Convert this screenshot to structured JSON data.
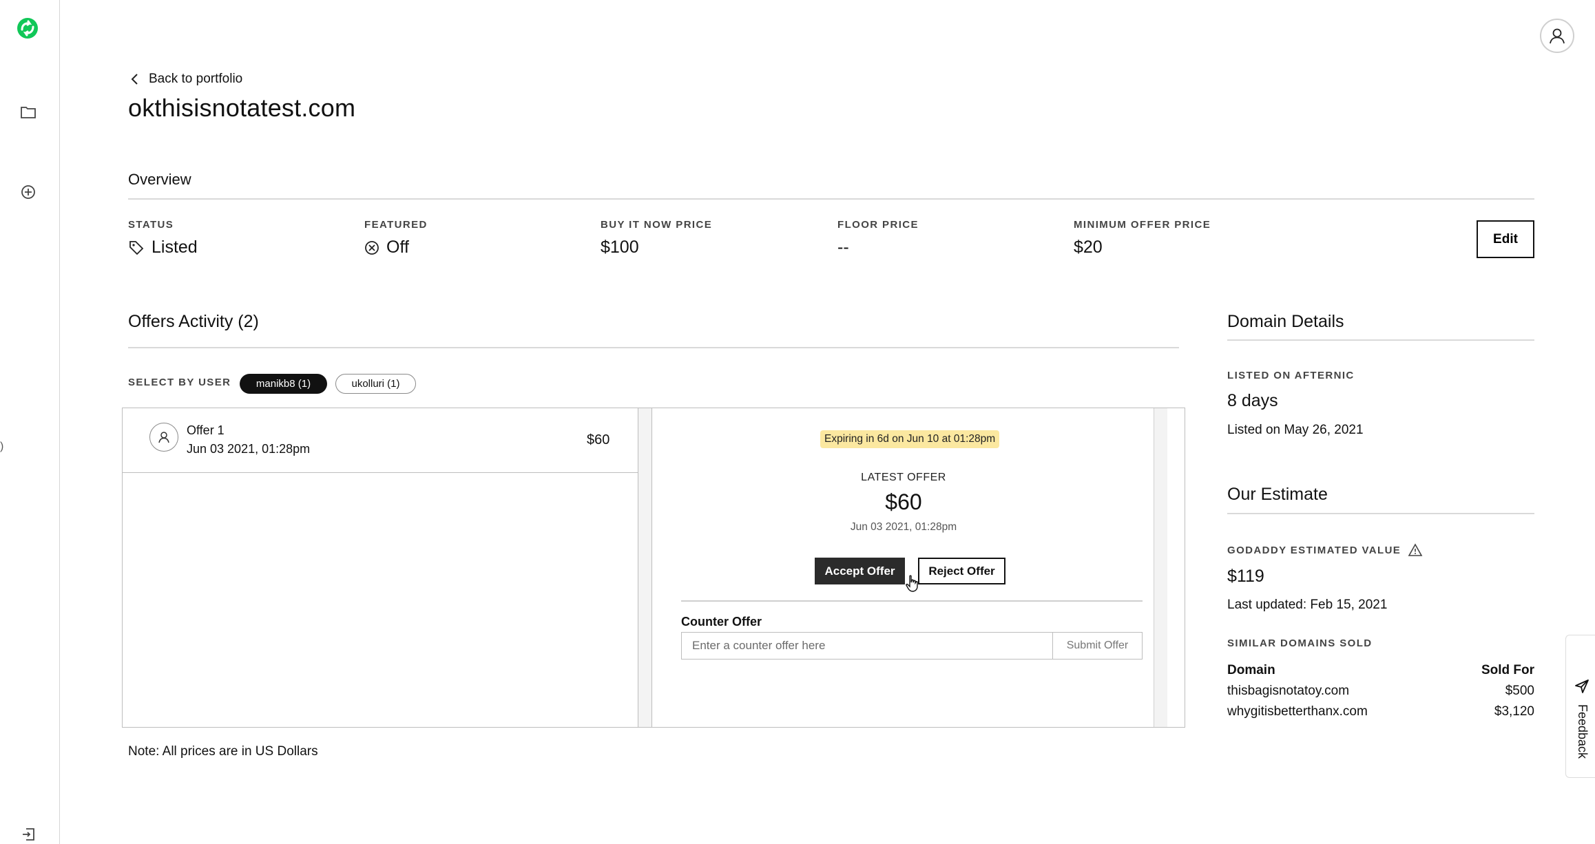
{
  "sidebar": {
    "logo_icon": "afternic-logo-icon",
    "items": [
      {
        "icon": "folder-icon"
      },
      {
        "icon": "plus-circle-icon"
      },
      {
        "icon": "sign-out-icon"
      }
    ],
    "edge_mark": ")"
  },
  "header": {
    "back_label": "Back to portfolio",
    "domain": "okthisisnotatest.com"
  },
  "overview": {
    "title": "Overview",
    "status": {
      "label": "STATUS",
      "value": "Listed"
    },
    "featured": {
      "label": "FEATURED",
      "value": "Off"
    },
    "buy_now": {
      "label": "BUY IT NOW PRICE",
      "value": "$100"
    },
    "floor": {
      "label": "FLOOR PRICE",
      "value": "--"
    },
    "min_offer": {
      "label": "MINIMUM OFFER PRICE",
      "value": "$20"
    },
    "edit_label": "Edit"
  },
  "offers": {
    "title": "Offers Activity (2)",
    "select_label": "SELECT BY USER",
    "users": [
      "manikb8 (1)",
      "ukolluri (1)"
    ],
    "list": [
      {
        "name": "Offer 1",
        "date": "Jun 03 2021, 01:28pm",
        "amount": "$60"
      }
    ],
    "detail": {
      "expiring": "Expiring in 6d on Jun 10 at 01:28pm",
      "latest_label": "LATEST OFFER",
      "latest_amount": "$60",
      "latest_date": "Jun 03 2021, 01:28pm",
      "accept_label": "Accept Offer",
      "reject_label": "Reject Offer",
      "counter_label": "Counter Offer",
      "counter_placeholder": "Enter a counter offer here",
      "submit_label": "Submit Offer"
    },
    "note": "Note: All prices are in US Dollars"
  },
  "domain_details": {
    "title": "Domain Details",
    "listed_label": "LISTED ON AFTERNIC",
    "listed_value": "8 days",
    "listed_on": "Listed on May 26, 2021"
  },
  "estimate": {
    "title": "Our Estimate",
    "value_label": "GODADDY ESTIMATED VALUE",
    "value": "$119",
    "updated": "Last updated: Feb 15, 2021",
    "similar_label": "SIMILAR DOMAINS SOLD",
    "columns": [
      "Domain",
      "Sold For"
    ],
    "rows": [
      {
        "domain": "thisbagisnotatoy.com",
        "price": "$500"
      },
      {
        "domain": "whygitisbetterthanx.com",
        "price": "$3,120"
      }
    ]
  },
  "feedback_label": "Feedback",
  "colors": {
    "brand_green": "#1bdbdb",
    "badge_yellow": "#fbe8a0",
    "button_dark": "#2b2b2b"
  }
}
